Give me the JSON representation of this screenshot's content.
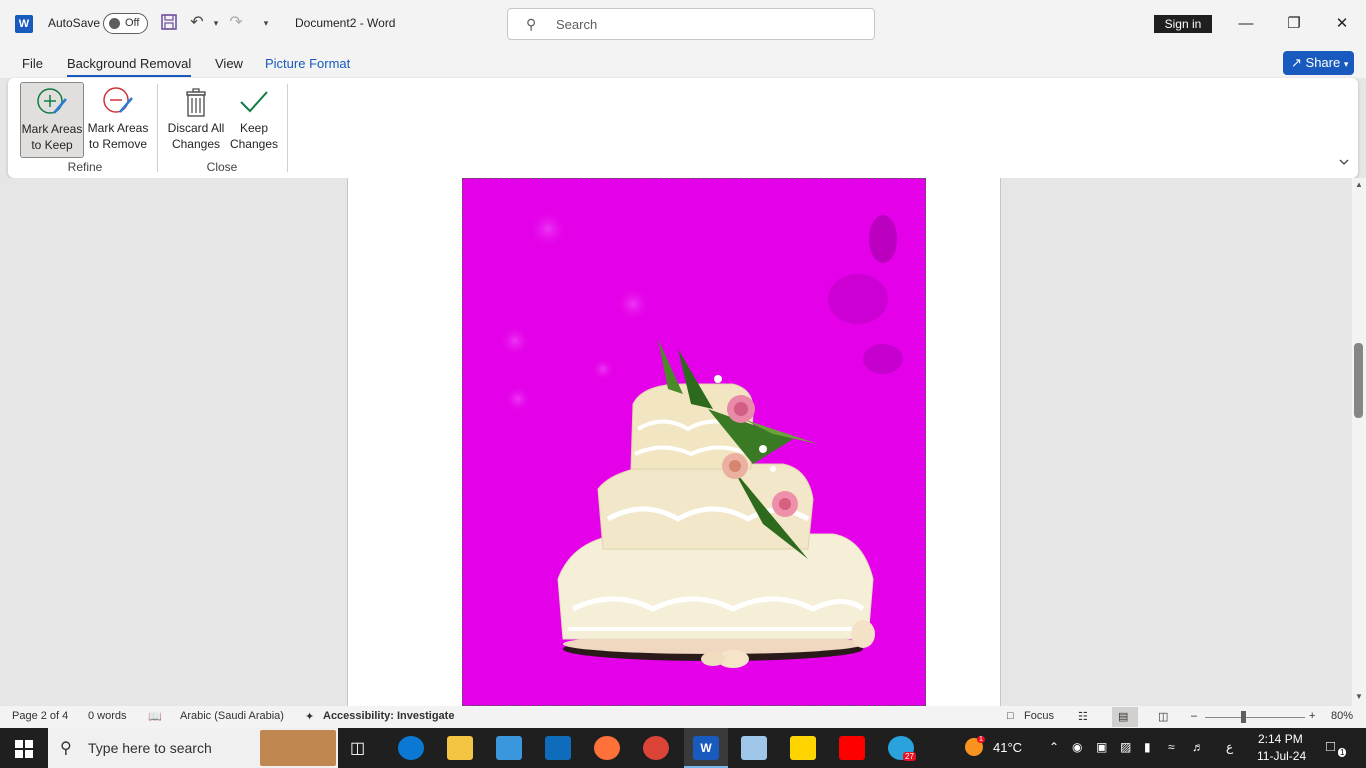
{
  "titlebar": {
    "autosave_label": "AutoSave",
    "autosave_state": "Off",
    "doc_title": "Document2  -  Word",
    "search_placeholder": "Search",
    "sign_in": "Sign in"
  },
  "tabs": {
    "file": "File",
    "background_removal": "Background Removal",
    "view": "View",
    "picture_format": "Picture Format",
    "share": "Share"
  },
  "ribbon": {
    "mark_keep": [
      "Mark Areas",
      "to Keep"
    ],
    "mark_remove": [
      "Mark Areas",
      "to Remove"
    ],
    "discard": [
      "Discard All",
      "Changes"
    ],
    "keep": [
      "Keep",
      "Changes"
    ],
    "group_refine": "Refine",
    "group_close": "Close"
  },
  "status": {
    "page": "Page 2 of 4",
    "words": "0 words",
    "language": "Arabic (Saudi Arabia)",
    "accessibility": "Accessibility: Investigate",
    "focus": "Focus",
    "zoom": "80%"
  },
  "taskbar": {
    "search_placeholder": "Type here to search",
    "weather": "41°C",
    "time": "2:14 PM",
    "date": "11-Jul-24",
    "telegram_badge": "27",
    "notification_badge": "1",
    "weather_badge": "1",
    "lang_indicator": "ع"
  },
  "colors": {
    "accent": "#185abd",
    "removal_magenta": "#e400e8"
  }
}
